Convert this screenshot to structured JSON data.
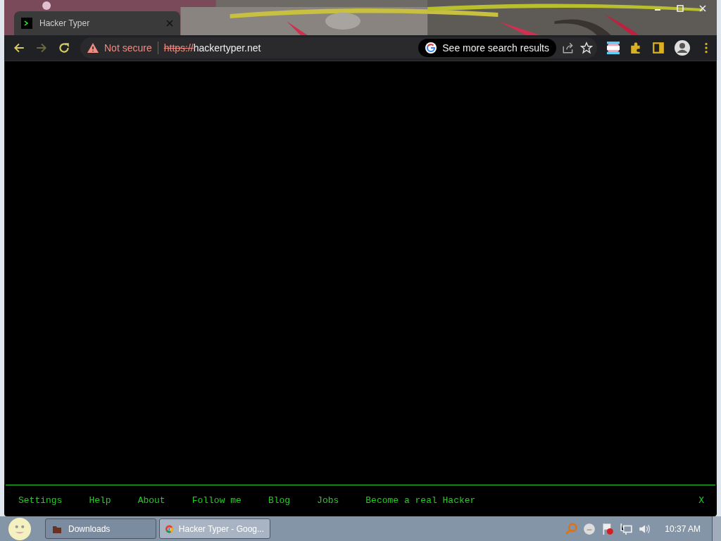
{
  "browser": {
    "tab": {
      "title": "Hacker Typer"
    },
    "toolbar": {
      "security": "Not secure",
      "url_scheme": "https://",
      "url_host": "hackertyper.net",
      "search_chip": "See more search results"
    }
  },
  "footer": {
    "links": [
      {
        "label": "Settings"
      },
      {
        "label": "Help"
      },
      {
        "label": "About"
      },
      {
        "label": "Follow me"
      },
      {
        "label": "Blog"
      },
      {
        "label": "Jobs"
      },
      {
        "label": "Become a real Hacker"
      }
    ],
    "close": "X"
  },
  "taskbar": {
    "buttons": [
      {
        "label": "Downloads",
        "kind": "folder",
        "selected": false
      },
      {
        "label": "Hacker Typer - Goog...",
        "kind": "chrome",
        "selected": true
      }
    ],
    "clock": "10:37 AM"
  }
}
